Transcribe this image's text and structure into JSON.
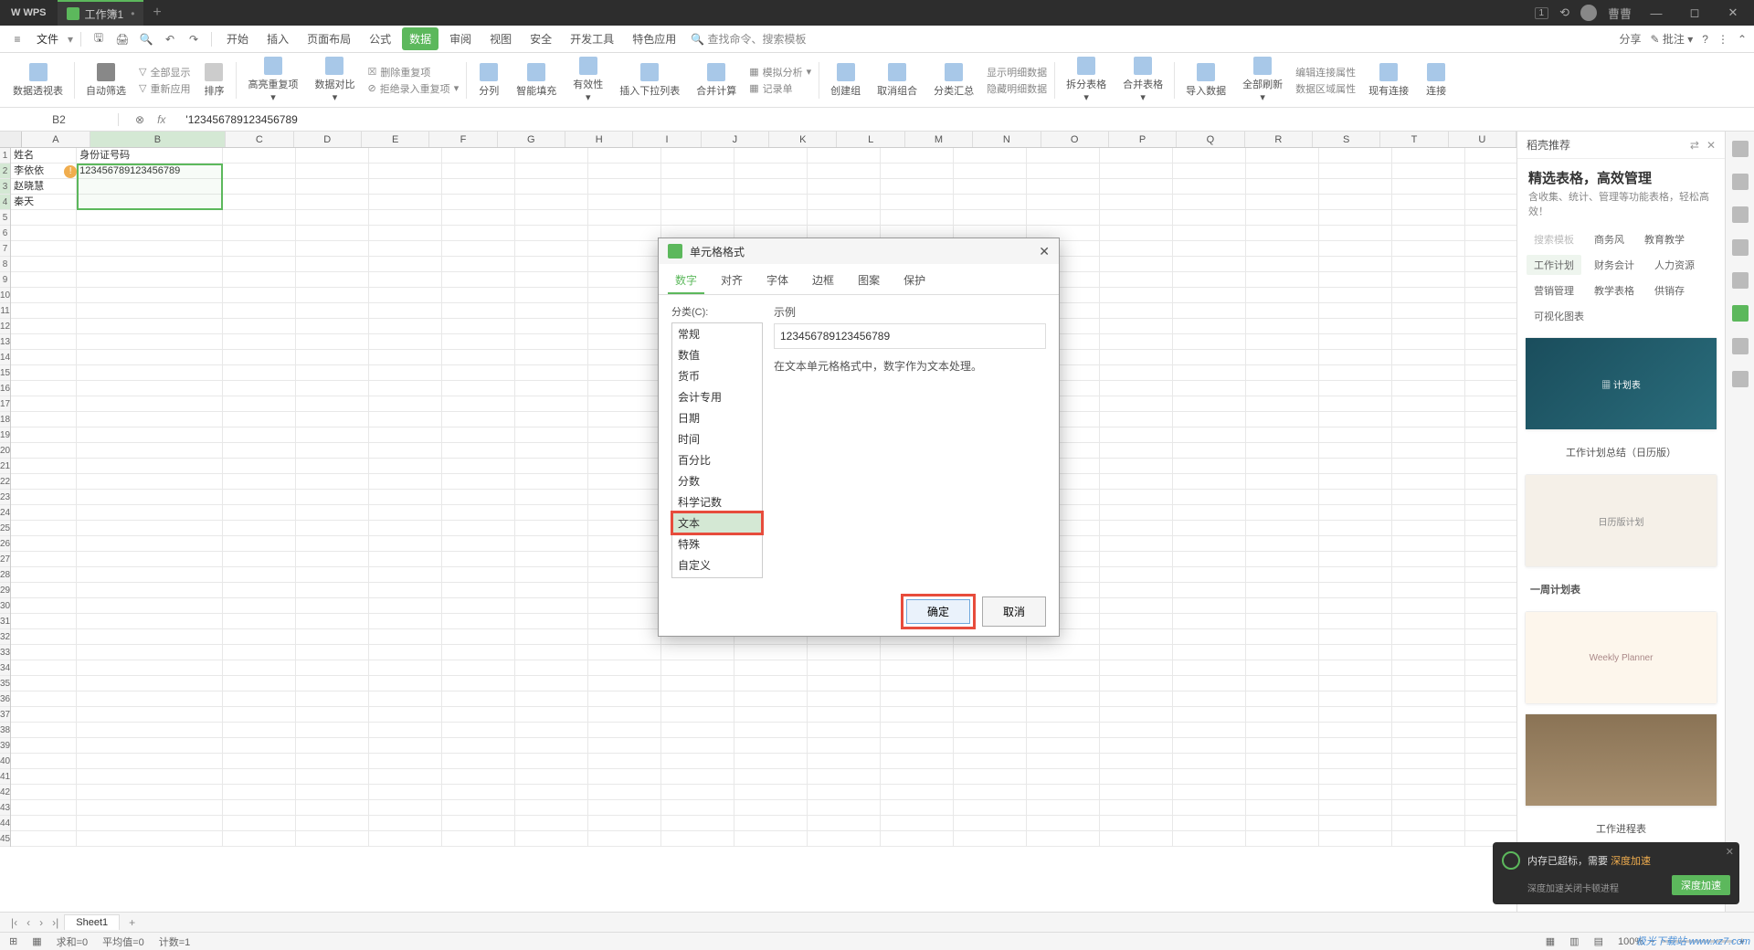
{
  "titlebar": {
    "app": "WPS",
    "tab_name": "工作簿1",
    "user": "曹曹",
    "badge": "1"
  },
  "menubar": {
    "file": "文件",
    "items": [
      "开始",
      "插入",
      "页面布局",
      "公式",
      "数据",
      "审阅",
      "视图",
      "安全",
      "开发工具",
      "特色应用"
    ],
    "active_index": 4,
    "search_icon": "🔍",
    "search_placeholder": "查找命令、搜索模板",
    "share": "分享",
    "comment": "批注"
  },
  "ribbon": {
    "items": [
      "数据透视表",
      "自动筛选",
      "全部显示",
      "重新应用",
      "排序",
      "高亮重复项",
      "数据对比",
      "删除重复项",
      "拒绝录入重复项",
      "分列",
      "智能填充",
      "有效性",
      "插入下拉列表",
      "合并计算",
      "模拟分析",
      "记录单",
      "创建组",
      "取消组合",
      "分类汇总",
      "显示明细数据",
      "隐藏明细数据",
      "拆分表格",
      "合并表格",
      "导入数据",
      "全部刷新",
      "编辑连接属性",
      "数据区域属性",
      "现有连接",
      "连接"
    ]
  },
  "formula_bar": {
    "cell_ref": "B2",
    "fx": "fx",
    "value": "'123456789123456789"
  },
  "grid": {
    "columns": [
      "A",
      "B",
      "C",
      "D",
      "E",
      "F",
      "G",
      "H",
      "I",
      "J",
      "K",
      "L",
      "M",
      "N",
      "O",
      "P",
      "Q",
      "R",
      "S",
      "T",
      "U"
    ],
    "selected_col": "B",
    "rows": [
      {
        "n": 1,
        "A": "姓名",
        "B": "身份证号码"
      },
      {
        "n": 2,
        "A": "李依依",
        "B": "123456789123456789"
      },
      {
        "n": 3,
        "A": "赵晓慧",
        "B": ""
      },
      {
        "n": 4,
        "A": "秦天",
        "B": ""
      }
    ],
    "row_count": 45,
    "selected_rows_start": 2,
    "selected_rows_end": 4
  },
  "dialog": {
    "title": "单元格格式",
    "tabs": [
      "数字",
      "对齐",
      "字体",
      "边框",
      "图案",
      "保护"
    ],
    "active_tab": 0,
    "category_label": "分类(C):",
    "categories": [
      "常规",
      "数值",
      "货币",
      "会计专用",
      "日期",
      "时间",
      "百分比",
      "分数",
      "科学记数",
      "文本",
      "特殊",
      "自定义"
    ],
    "selected_category": "文本",
    "preview_label": "示例",
    "preview_value": "123456789123456789",
    "description": "在文本单元格格式中，数字作为文本处理。",
    "ok": "确定",
    "cancel": "取消"
  },
  "panel": {
    "header": "稻壳推荐",
    "title": "精选表格，高效管理",
    "subtitle": "含收集、统计、管理等功能表格，轻松高效！",
    "search_placeholder": "搜索模板",
    "tags": [
      "商务风",
      "教育教学",
      "工作计划",
      "财务会计",
      "人力资源",
      "营销管理",
      "教学表格",
      "供销存",
      "可视化图表"
    ],
    "templates": [
      "工作计划总结（日历版）",
      "一周计划表",
      "工作进程表"
    ]
  },
  "sheet_tabs": {
    "active": "Sheet1"
  },
  "status": {
    "sum": "求和=0",
    "avg": "平均值=0",
    "count": "计数=1",
    "zoom": "100%"
  },
  "toast": {
    "msg_prefix": "内存已超标，需要",
    "msg_accel": "深度加速",
    "sub": "深度加速关闭卡顿进程",
    "btn": "深度加速"
  },
  "watermark": "极光下载站 www.xz7.com"
}
